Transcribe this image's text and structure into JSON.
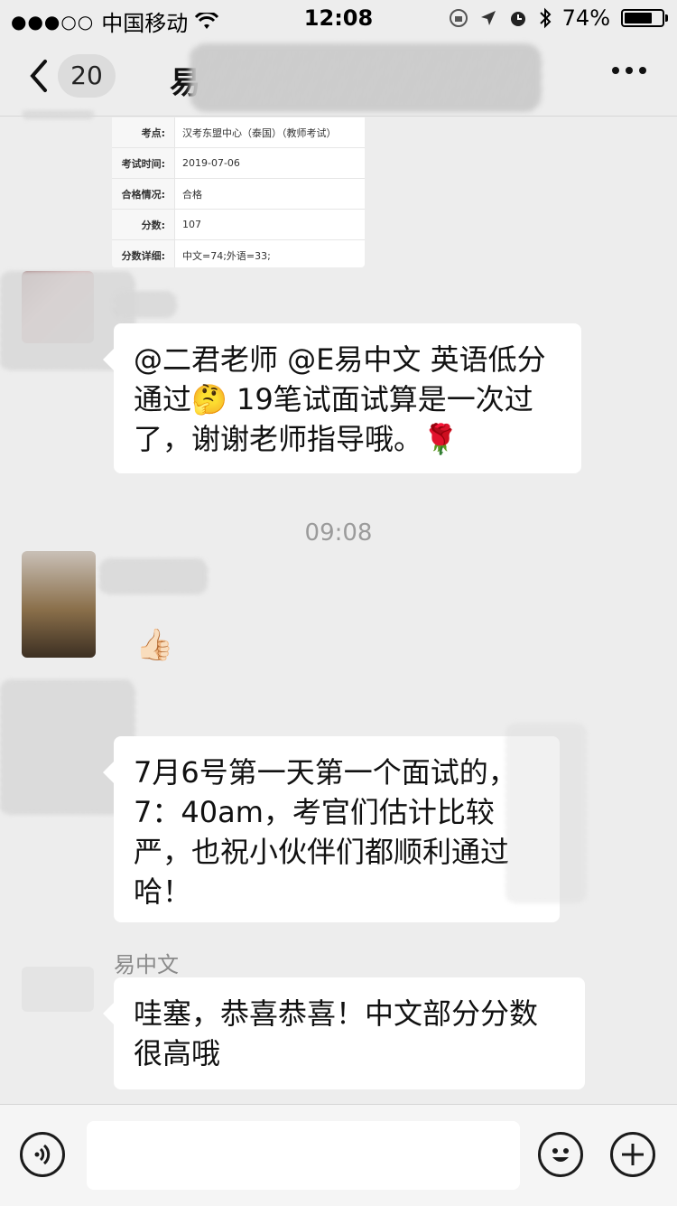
{
  "status_bar": {
    "carrier": "中国移动",
    "time": "12:08",
    "battery_text": "74%",
    "battery_level": 0.74
  },
  "nav": {
    "badge_count": "20",
    "title": "易"
  },
  "exam_card": {
    "rows": [
      {
        "key": "考点:",
        "value": "汉考东盟中心（泰国）（教师考试）"
      },
      {
        "key": "考试时间:",
        "value": "2019-07-06"
      },
      {
        "key": "合格情况:",
        "value": "合格"
      },
      {
        "key": "分数:",
        "value": "107"
      },
      {
        "key": "分数详细:",
        "value": "中文=74;外语=33;"
      }
    ]
  },
  "messages": [
    {
      "text": "@二君老师 @E易中文 英语低分通过🤔 19笔试面试算是一次过了，谢谢老师指导哦。🌹"
    },
    {
      "text": "👍🏻"
    },
    {
      "text": "7月6号第一天第一个面试的，7：40am，考官们估计比较严，也祝小伙伴们都顺利通过哈！"
    },
    {
      "sender": "易中文",
      "text": "哇塞，恭喜恭喜！中文部分分数很高哦"
    }
  ],
  "timestamp": "09:08",
  "icons": {
    "back": "chevron-left-icon",
    "more": "more-icon",
    "voice": "voice-icon",
    "emoji": "emoji-icon",
    "add": "plus-icon"
  }
}
